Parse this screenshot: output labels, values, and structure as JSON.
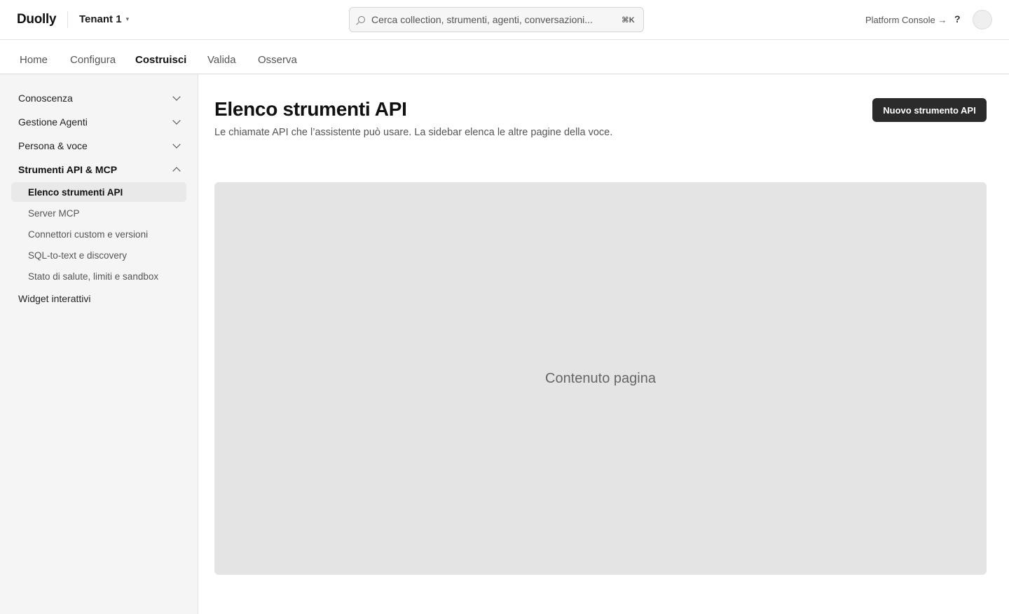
{
  "header": {
    "brand": "Duolly",
    "tenant": "Tenant 1",
    "tenant_caret": "▾",
    "search_placeholder": "Cerca collection, strumenti, agenti, conversazioni...",
    "search_shortcut": "⌘K",
    "platform_console": "Platform Console →",
    "help": "?"
  },
  "tabs": [
    {
      "label": "Home",
      "active": false
    },
    {
      "label": "Configura",
      "active": false
    },
    {
      "label": "Costruisci",
      "active": true
    },
    {
      "label": "Valida",
      "active": false
    },
    {
      "label": "Osserva",
      "active": false
    }
  ],
  "sidebar": {
    "sections": [
      {
        "label": "Conoscenza",
        "expanded": false
      },
      {
        "label": "Gestione Agenti",
        "expanded": false
      },
      {
        "label": "Persona & voce",
        "expanded": false
      },
      {
        "label": "Strumenti API & MCP",
        "expanded": true
      },
      {
        "label": "Widget interattivi",
        "expanded": false
      }
    ],
    "sub_items": [
      {
        "label": "Elenco strumenti API",
        "active": true
      },
      {
        "label": "Server MCP",
        "active": false
      },
      {
        "label": "Connettori custom e versioni",
        "active": false
      },
      {
        "label": "SQL-to-text e discovery",
        "active": false
      },
      {
        "label": "Stato di salute, limiti e sandbox",
        "active": false
      }
    ]
  },
  "main": {
    "title": "Elenco strumenti API",
    "subtitle": "Le chiamate API che l’assistente può usare. La sidebar elenca le altre pagine della voce.",
    "new_button": "Nuovo strumento API",
    "placeholder": "Contenuto pagina"
  },
  "colors": {
    "primary_button": "#2b2b2b",
    "sidebar_bg": "#f5f5f5",
    "content_placeholder_bg": "#e4e4e4"
  }
}
